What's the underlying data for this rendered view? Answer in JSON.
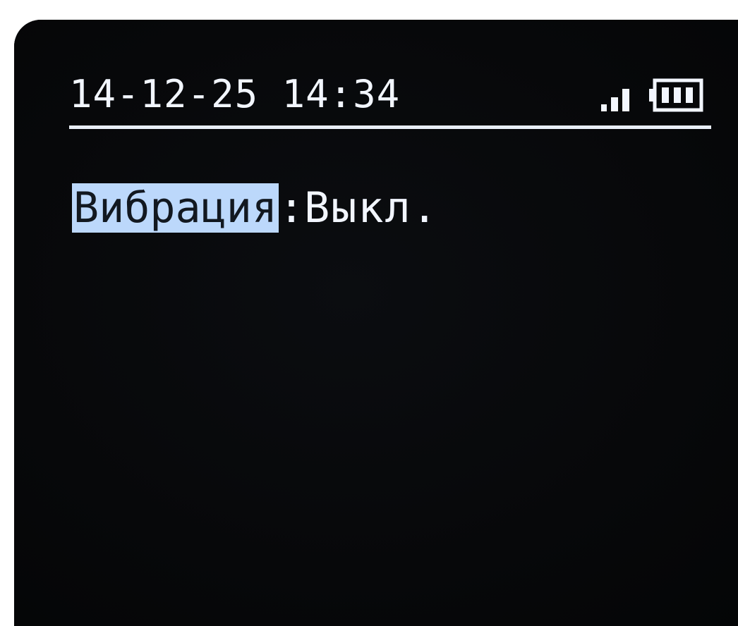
{
  "status_bar": {
    "datetime": "14-12-25 14:34",
    "signal_icon": "signal-strength-icon",
    "battery_icon": "battery-icon",
    "signal_bars": 3,
    "battery_bars": 3
  },
  "setting": {
    "label": "Вибрация",
    "separator": ":",
    "value": "Выкл."
  },
  "colors": {
    "screen_background": "#060708",
    "text": "#f2f6ff",
    "highlight": "#bcd8fb",
    "highlight_text": "#121820"
  }
}
